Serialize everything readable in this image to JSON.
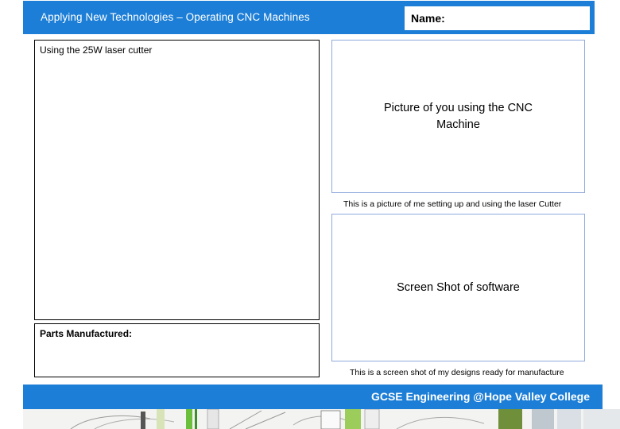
{
  "header": {
    "title": "Applying New Technologies – Operating CNC Machines",
    "name_label": "Name:"
  },
  "left_panel": {
    "label": "Using the 25W laser cutter"
  },
  "parts_panel": {
    "label": "Parts Manufactured:"
  },
  "photo_box": {
    "placeholder": "Picture of you using the CNC Machine",
    "caption": "This is a picture of me setting up and using the laser Cutter"
  },
  "screenshot_box": {
    "placeholder": "Screen Shot of software",
    "caption": "This is a screen shot of my designs ready for manufacture"
  },
  "footer": {
    "text": "GCSE Engineering @Hope Valley College"
  },
  "colors": {
    "header_blue": "#1c7ed6",
    "box_border": "#8faadc"
  }
}
